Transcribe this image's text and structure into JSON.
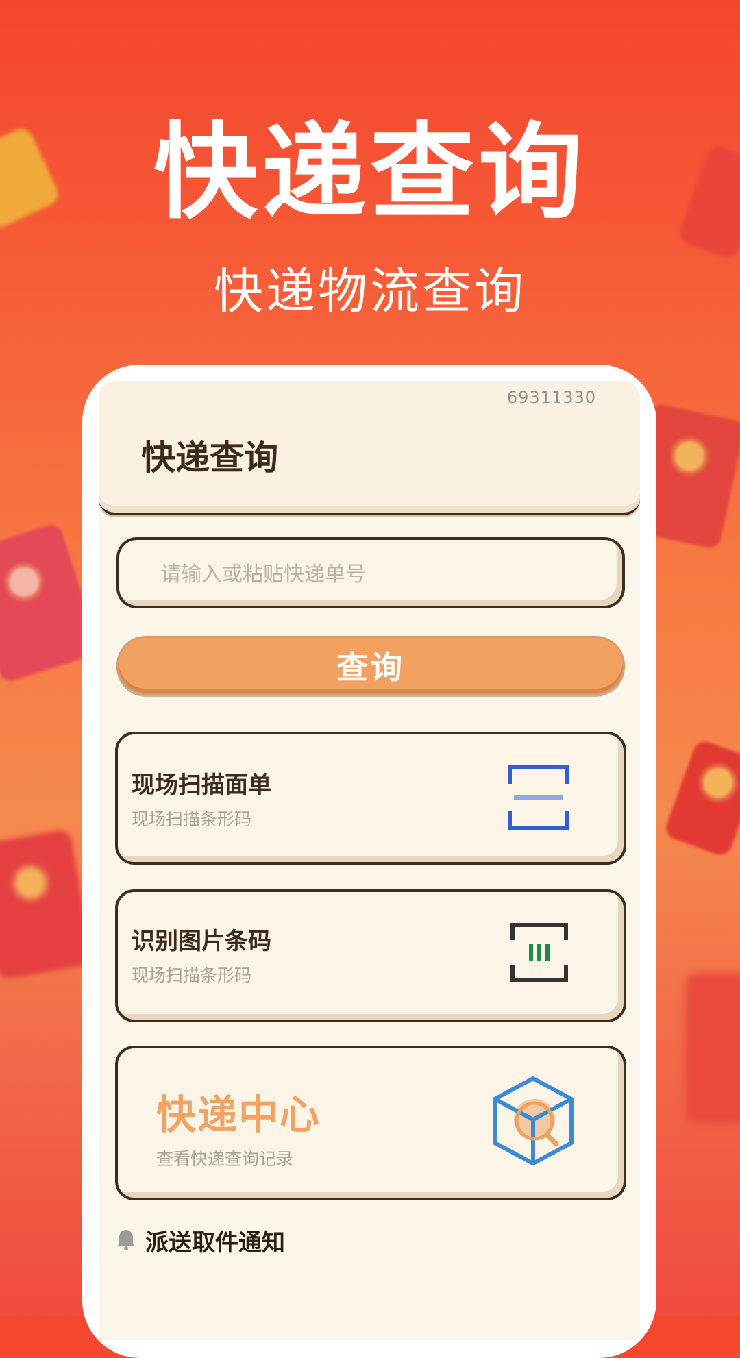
{
  "hero": {
    "title": "快递查询",
    "subtitle": "快递物流查询"
  },
  "app": {
    "code": "69311330",
    "header_title": "快递查询",
    "input_placeholder": "请输入或粘贴快递单号",
    "query_button": "查询",
    "options": [
      {
        "title": "现场扫描面单",
        "subtitle": "现场扫描条形码",
        "icon": "scan-frame-icon"
      },
      {
        "title": "识别图片条码",
        "subtitle": "现场扫描条形码",
        "icon": "barcode-image-icon"
      }
    ],
    "center": {
      "title": "快递中心",
      "subtitle": "查看快递查询记录",
      "icon": "package-search-icon"
    },
    "notice": {
      "label": "派送取件通知",
      "icon": "bell-icon"
    }
  },
  "colors": {
    "background_top": "#f5452e",
    "background_mid": "#f77a43",
    "accent_orange": "#f3a160",
    "card_border": "#3e2c1e",
    "card_bg": "#fcf4e6",
    "scan_blue": "#2f5fd6",
    "barcode_green": "#1f8a4c",
    "cube_blue": "#3b8ad9"
  }
}
